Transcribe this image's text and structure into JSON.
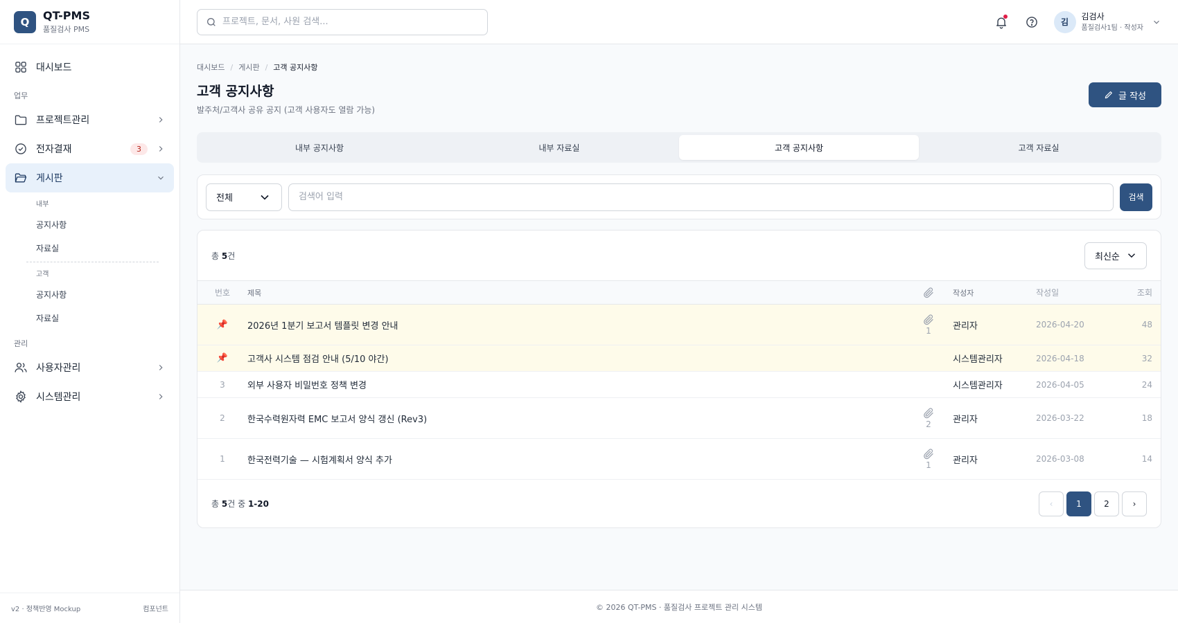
{
  "brand": {
    "logo_letter": "Q",
    "name": "QT-PMS",
    "subtitle": "품질검사 PMS"
  },
  "sidebar": {
    "dashboard": "대시보드",
    "section_work": "업무",
    "project": "프로젝트관리",
    "approval": "전자결재",
    "approval_badge": "3",
    "board": "게시판",
    "board_internal_label": "내부",
    "board_internal_notice": "공지사항",
    "board_internal_archive": "자료실",
    "board_customer_label": "고객",
    "board_customer_notice": "공지사항",
    "board_customer_archive": "자료실",
    "section_admin": "관리",
    "users": "사용자관리",
    "system": "시스템관리",
    "footer_left": "v2 · 정책반영 Mockup",
    "footer_right": "컴포넌트"
  },
  "header": {
    "search_placeholder": "프로젝트, 문서, 사원 검색...",
    "user_initial": "김",
    "user_name": "김검사",
    "user_role": "품질검사1팀 · 작성자"
  },
  "breadcrumb": [
    "대시보드",
    "게시판",
    "고객 공지사항"
  ],
  "page": {
    "title": "고객 공지사항",
    "subtitle": "발주처/고객사 공유 공지 (고객 사용자도 열람 가능)",
    "write_label": "글 작성"
  },
  "tabs": [
    "내부 공지사항",
    "내부 자료실",
    "고객 공지사항",
    "고객 자료실"
  ],
  "active_tab": 2,
  "filter": {
    "select_value": "전체",
    "input_placeholder": "검색어 입력",
    "search_label": "검색"
  },
  "list": {
    "count_prefix": "총 ",
    "count": "5",
    "count_suffix": "건",
    "sort_label": "최신순",
    "columns": {
      "no": "번호",
      "title": "제목",
      "author": "작성자",
      "date": "작성일",
      "views": "조회"
    },
    "rows": [
      {
        "pinned": true,
        "no": "",
        "title": "2026년 1분기 보고서 템플릿 변경 안내",
        "attach": "1",
        "author": "관리자",
        "date": "2026-04-20",
        "views": "48"
      },
      {
        "pinned": true,
        "no": "",
        "title": "고객사 시스템 점검 안내 (5/10 야간)",
        "attach": "",
        "author": "시스템관리자",
        "date": "2026-04-18",
        "views": "32"
      },
      {
        "pinned": false,
        "no": "3",
        "title": "외부 사용자 비밀번호 정책 변경",
        "attach": "",
        "author": "시스템관리자",
        "date": "2026-04-05",
        "views": "24"
      },
      {
        "pinned": false,
        "no": "2",
        "title": "한국수력원자력 EMC 보고서 양식 갱신 (Rev3)",
        "attach": "2",
        "author": "관리자",
        "date": "2026-03-22",
        "views": "18"
      },
      {
        "pinned": false,
        "no": "1",
        "title": "한국전력기술 — 시험계획서 양식 추가",
        "attach": "1",
        "author": "관리자",
        "date": "2026-03-08",
        "views": "14"
      }
    ],
    "range_prefix": "총 ",
    "range_count": "5",
    "range_mid": "건 중 ",
    "range_value": "1-20",
    "pages": [
      "1",
      "2"
    ],
    "prev": "‹",
    "next": "›"
  },
  "footer": "© 2026 QT-PMS · 품질검사 프로젝트 관리 시스템",
  "colors": {
    "primary": "#2f5381",
    "pinned_row": "#fefbea",
    "active_nav": "#e8f1fb",
    "badge_bg": "#fde8e8"
  }
}
